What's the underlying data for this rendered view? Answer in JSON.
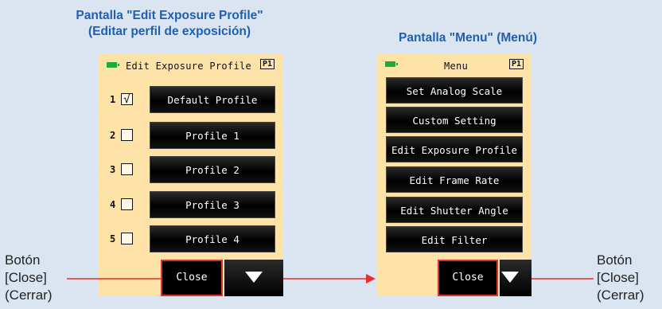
{
  "left_caption": {
    "line1": "Pantalla \"Edit Exposure Profile\"",
    "line2": "(Editar perfil de exposición)"
  },
  "right_caption": "Pantalla \"Menu\" (Menú)",
  "left_callout": [
    "Botón",
    "[Close]",
    "(Cerrar)"
  ],
  "right_callout": [
    "Botón",
    "[Close]",
    "(Cerrar)"
  ],
  "edit_screen": {
    "title": "Edit Exposure Profile",
    "page": "P1",
    "rows": [
      {
        "num": "1",
        "checked": true,
        "check_mark": "√",
        "label": "Default Profile"
      },
      {
        "num": "2",
        "checked": false,
        "check_mark": "",
        "label": "Profile 1"
      },
      {
        "num": "3",
        "checked": false,
        "check_mark": "",
        "label": "Profile 2"
      },
      {
        "num": "4",
        "checked": false,
        "check_mark": "",
        "label": "Profile 3"
      },
      {
        "num": "5",
        "checked": false,
        "check_mark": "",
        "label": "Profile 4"
      }
    ],
    "close_label": "Close"
  },
  "menu_screen": {
    "title": "Menu",
    "page": "P1",
    "items": [
      "Set Analog Scale",
      "Custom Setting",
      "Edit Exposure Profile",
      "Edit Frame Rate",
      "Edit Shutter Angle",
      "Edit Filter"
    ],
    "close_label": "Close"
  },
  "colors": {
    "caption": "#1f5fb1",
    "screen_bg": "#fde3a7",
    "highlight": "#e03030",
    "battery": "#1fa83b"
  },
  "icons": [
    "battery-icon",
    "down-arrow-icon"
  ]
}
